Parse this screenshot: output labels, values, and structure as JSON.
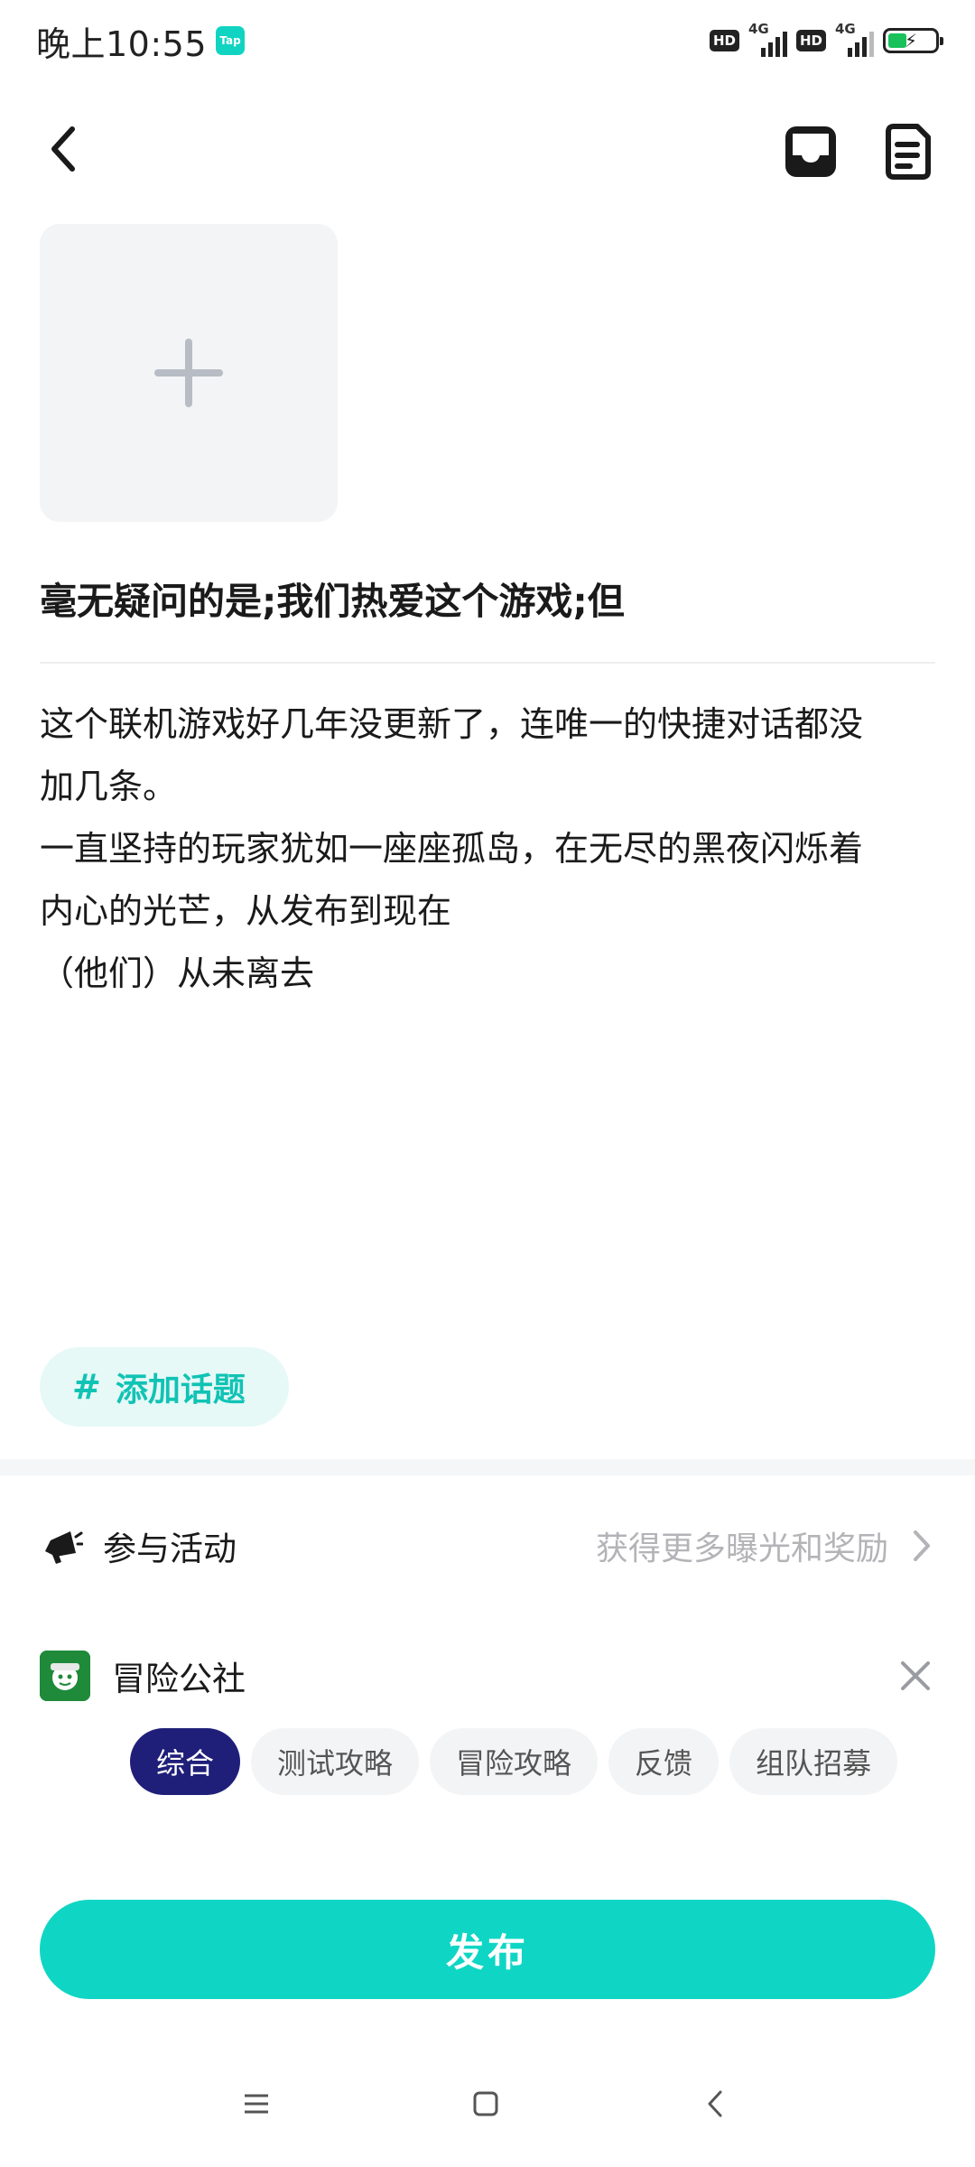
{
  "status_bar": {
    "time": "晚上10:55",
    "app_badge": "Tap",
    "hd_label": "HD",
    "network_label": "4G"
  },
  "post": {
    "title": "毫无疑问的是;我们热爱这个游戏;但",
    "body_lines": [
      "这个联机游戏好几年没更新了，连唯一的快捷对话都没",
      "加几条。",
      "一直坚持的玩家犹如一座座孤岛，在无尽的黑夜闪烁着",
      "内心的光芒，从发布到现在",
      "（他们）从未离去"
    ]
  },
  "topic": {
    "hash": "#",
    "label": "添加话题"
  },
  "activity": {
    "label": "参与活动",
    "hint": "获得更多曝光和奖励"
  },
  "group": {
    "name": "冒险公社",
    "categories": [
      {
        "label": "综合",
        "active": true
      },
      {
        "label": "测试攻略",
        "active": false
      },
      {
        "label": "冒险攻略",
        "active": false
      },
      {
        "label": "反馈",
        "active": false
      },
      {
        "label": "组队招募",
        "active": false
      }
    ]
  },
  "publish_label": "发布",
  "colors": {
    "accent": "#0fd6c4",
    "active_tab": "#1f1f7a",
    "topic_bg": "#e6f9f7",
    "hint_text": "#b4b4b8"
  },
  "icons": {
    "back": "chevron-left-icon",
    "drafts": "inbox-icon",
    "notes": "document-icon",
    "add_image": "plus-icon",
    "activity": "megaphone-icon",
    "more": "chevron-right-icon",
    "remove": "close-icon"
  }
}
